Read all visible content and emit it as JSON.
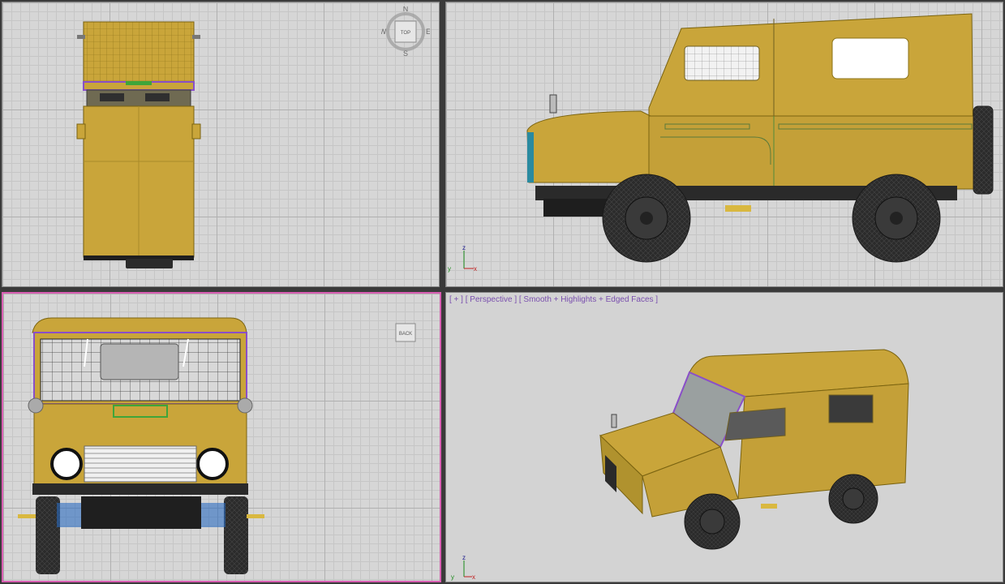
{
  "viewports": {
    "top": {
      "cube_label": "TOP",
      "compass": {
        "n": "N",
        "s": "S",
        "e": "E",
        "w": "W"
      }
    },
    "left": {
      "axis": {
        "z": "z",
        "y": "y",
        "x": "x"
      }
    },
    "back": {
      "cube_label": "BACK"
    },
    "perspective": {
      "label_plus": "[ + ]",
      "label_view": "[ Perspective ]",
      "label_shading": "[ Smooth + Highlights + Edged Faces ]",
      "axis": {
        "z": "z",
        "y": "y",
        "x": "x"
      }
    }
  },
  "colors": {
    "body": "#c9a53a",
    "body_dark": "#9a7e24",
    "wire": "#7a6310",
    "tire": "#2b2b2b",
    "active_border": "#d95fb3",
    "selection_green": "#3fa53a",
    "selection_purple": "#8a4fc8"
  }
}
